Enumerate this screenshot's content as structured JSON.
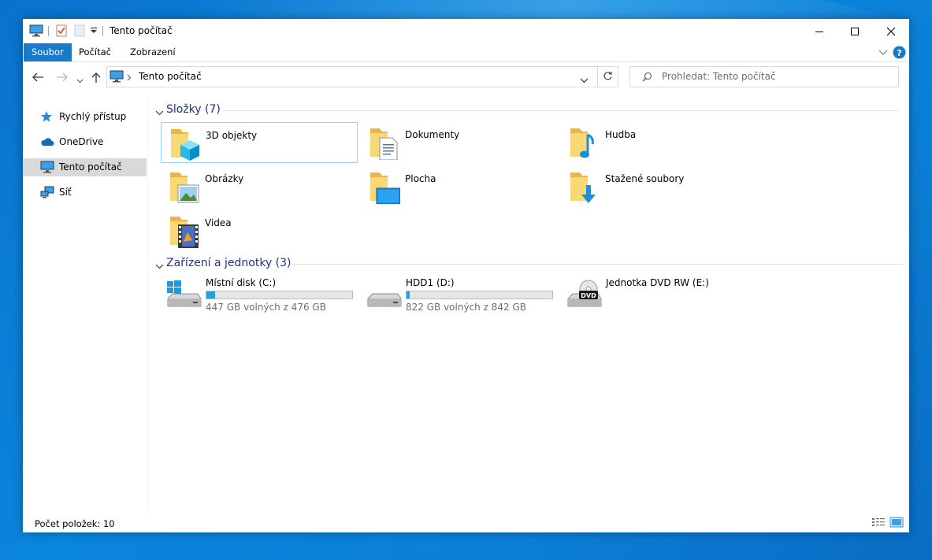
{
  "window": {
    "title": "Tento počítač"
  },
  "ribbon": {
    "tabs": [
      "Soubor",
      "Počítač",
      "Zobrazení"
    ],
    "active_tab": "Soubor"
  },
  "address": {
    "path": "Tento počítač"
  },
  "search": {
    "placeholder": "Prohledat: Tento počítač"
  },
  "sidebar": {
    "items": [
      {
        "label": "Rychlý přístup",
        "icon": "star-icon"
      },
      {
        "label": "OneDrive",
        "icon": "cloud-icon"
      },
      {
        "label": "Tento počítač",
        "icon": "computer-icon",
        "selected": true
      },
      {
        "label": "Síť",
        "icon": "network-icon"
      }
    ]
  },
  "folders": {
    "header": "Složky (7)",
    "items": [
      {
        "label": "3D objekty",
        "icon": "3d-objects-folder-icon"
      },
      {
        "label": "Dokumenty",
        "icon": "documents-folder-icon"
      },
      {
        "label": "Hudba",
        "icon": "music-folder-icon"
      },
      {
        "label": "Obrázky",
        "icon": "pictures-folder-icon"
      },
      {
        "label": "Plocha",
        "icon": "desktop-folder-icon"
      },
      {
        "label": "Stažené soubory",
        "icon": "downloads-folder-icon"
      },
      {
        "label": "Videa",
        "icon": "videos-folder-icon"
      }
    ]
  },
  "drives": {
    "header": "Zařízení a jednotky (3)",
    "items": [
      {
        "label": "Místní disk (C:)",
        "free_text": "447 GB volných z 476 GB",
        "used_fraction": 0.061,
        "icon": "windows-drive-icon"
      },
      {
        "label": "HDD1 (D:)",
        "free_text": "822 GB volných z 842 GB",
        "used_fraction": 0.024,
        "icon": "hard-drive-icon"
      },
      {
        "label": "Jednotka DVD RW (E:)",
        "free_text": "",
        "icon": "dvd-drive-icon",
        "dvd_label": "DVD"
      }
    ]
  },
  "status": {
    "count": "Počet položek: 10"
  },
  "colors": {
    "accent": "#1979ca",
    "group_header": "#1e3287",
    "progress": "#26a0da",
    "folder": "#f8d775"
  }
}
